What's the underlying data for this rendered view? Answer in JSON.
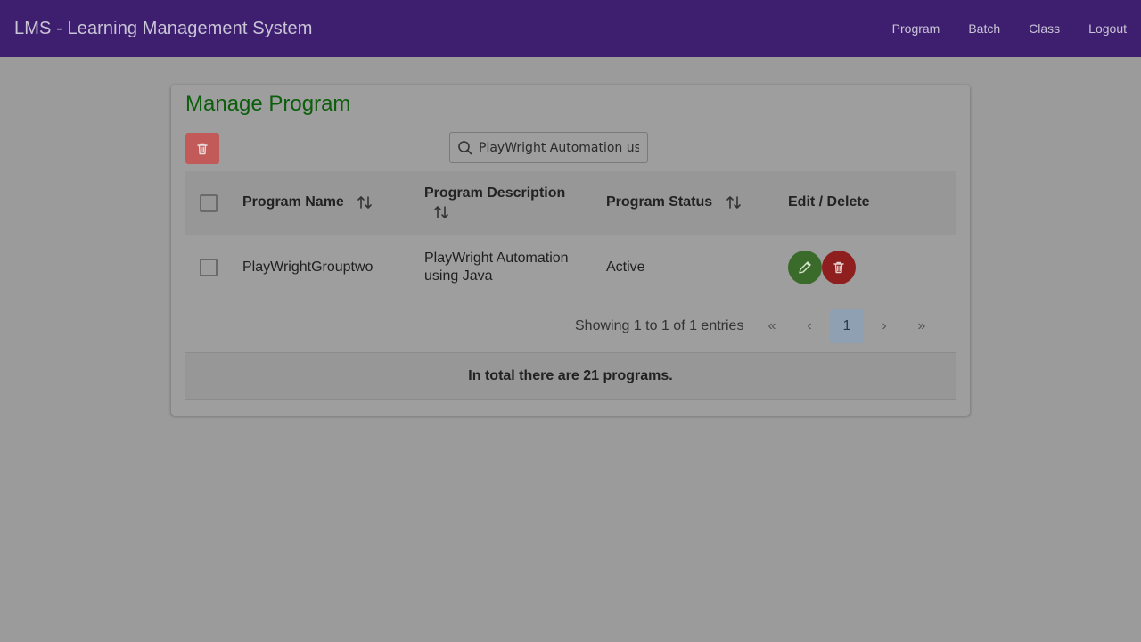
{
  "app": {
    "title": "LMS - Learning Management System"
  },
  "nav": {
    "items": [
      "Program",
      "Batch",
      "Class",
      "Logout"
    ]
  },
  "page": {
    "title": "Manage Program"
  },
  "search": {
    "value": "PlayWright Automation us",
    "placeholder": ""
  },
  "table": {
    "headers": {
      "name": "Program Name",
      "description": "Program Description",
      "status": "Program Status",
      "actions": "Edit / Delete"
    },
    "rows": [
      {
        "name": "PlayWrightGrouptwo",
        "description_line1": "PlayWright Automation",
        "description_line2": "using Java",
        "status": "Active"
      }
    ]
  },
  "pagination": {
    "info": "Showing 1 to 1 of 1 entries",
    "current_page": "1",
    "first_icon": "«",
    "prev_icon": "‹",
    "next_icon": "›",
    "last_icon": "»"
  },
  "summary": {
    "text": "In total there are 21 programs."
  },
  "colors": {
    "topbar": "#3e1f6f",
    "title": "#0c5e0c",
    "edit": "#3b6b2a",
    "delete": "#8f1f1f"
  }
}
